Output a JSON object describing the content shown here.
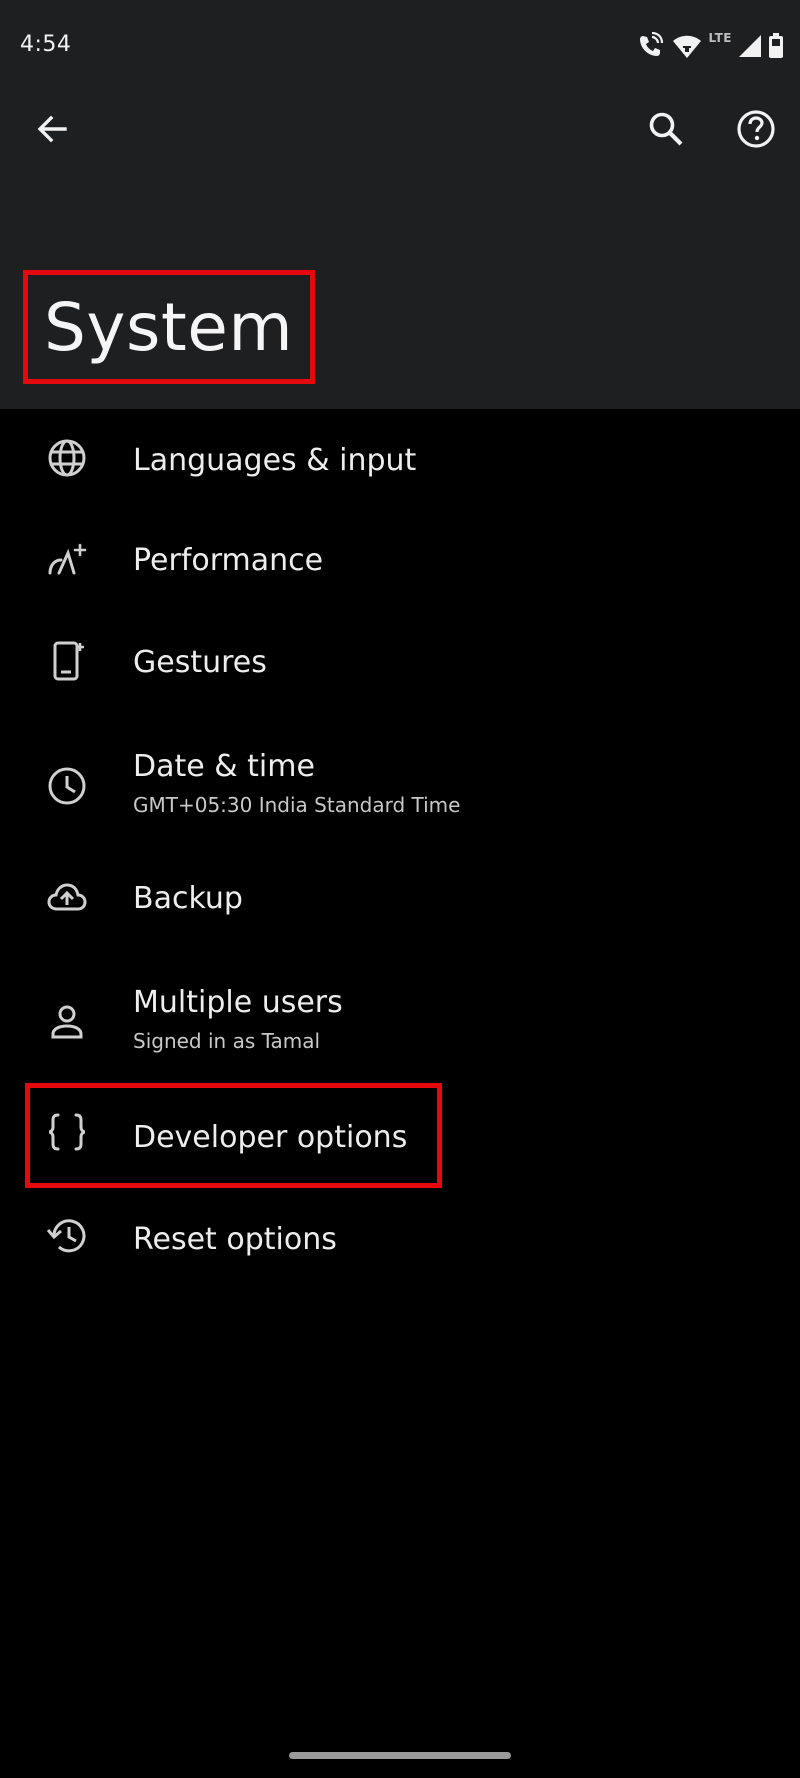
{
  "status_bar": {
    "time": "4:54",
    "network": "LTE",
    "icons": [
      "wifi-calling-icon",
      "wifi-icon",
      "signal-icon",
      "battery-icon"
    ]
  },
  "toolbar": {
    "back_icon": "arrow-left-icon",
    "search_icon": "search-icon",
    "help_icon": "help-circle-icon"
  },
  "page": {
    "title": "System"
  },
  "settings": [
    {
      "title": "Languages & input",
      "subtitle": "",
      "icon": "globe-icon"
    },
    {
      "title": "Performance",
      "subtitle": "",
      "icon": "performance-icon"
    },
    {
      "title": "Gestures",
      "subtitle": "",
      "icon": "gestures-icon"
    },
    {
      "title": "Date & time",
      "subtitle": "GMT+05:30 India Standard Time",
      "icon": "clock-icon"
    },
    {
      "title": "Backup",
      "subtitle": "",
      "icon": "cloud-upload-icon"
    },
    {
      "title": "Multiple users",
      "subtitle": "Signed in as Tamal",
      "icon": "user-icon"
    },
    {
      "title": "Developer options",
      "subtitle": "",
      "icon": "braces-icon"
    },
    {
      "title": "Reset options",
      "subtitle": "",
      "icon": "history-icon"
    }
  ],
  "colors": {
    "header_bg": "#1E1F21",
    "page_bg": "#000000",
    "highlight": "#E5090E",
    "icon": "#D0D0D0"
  }
}
